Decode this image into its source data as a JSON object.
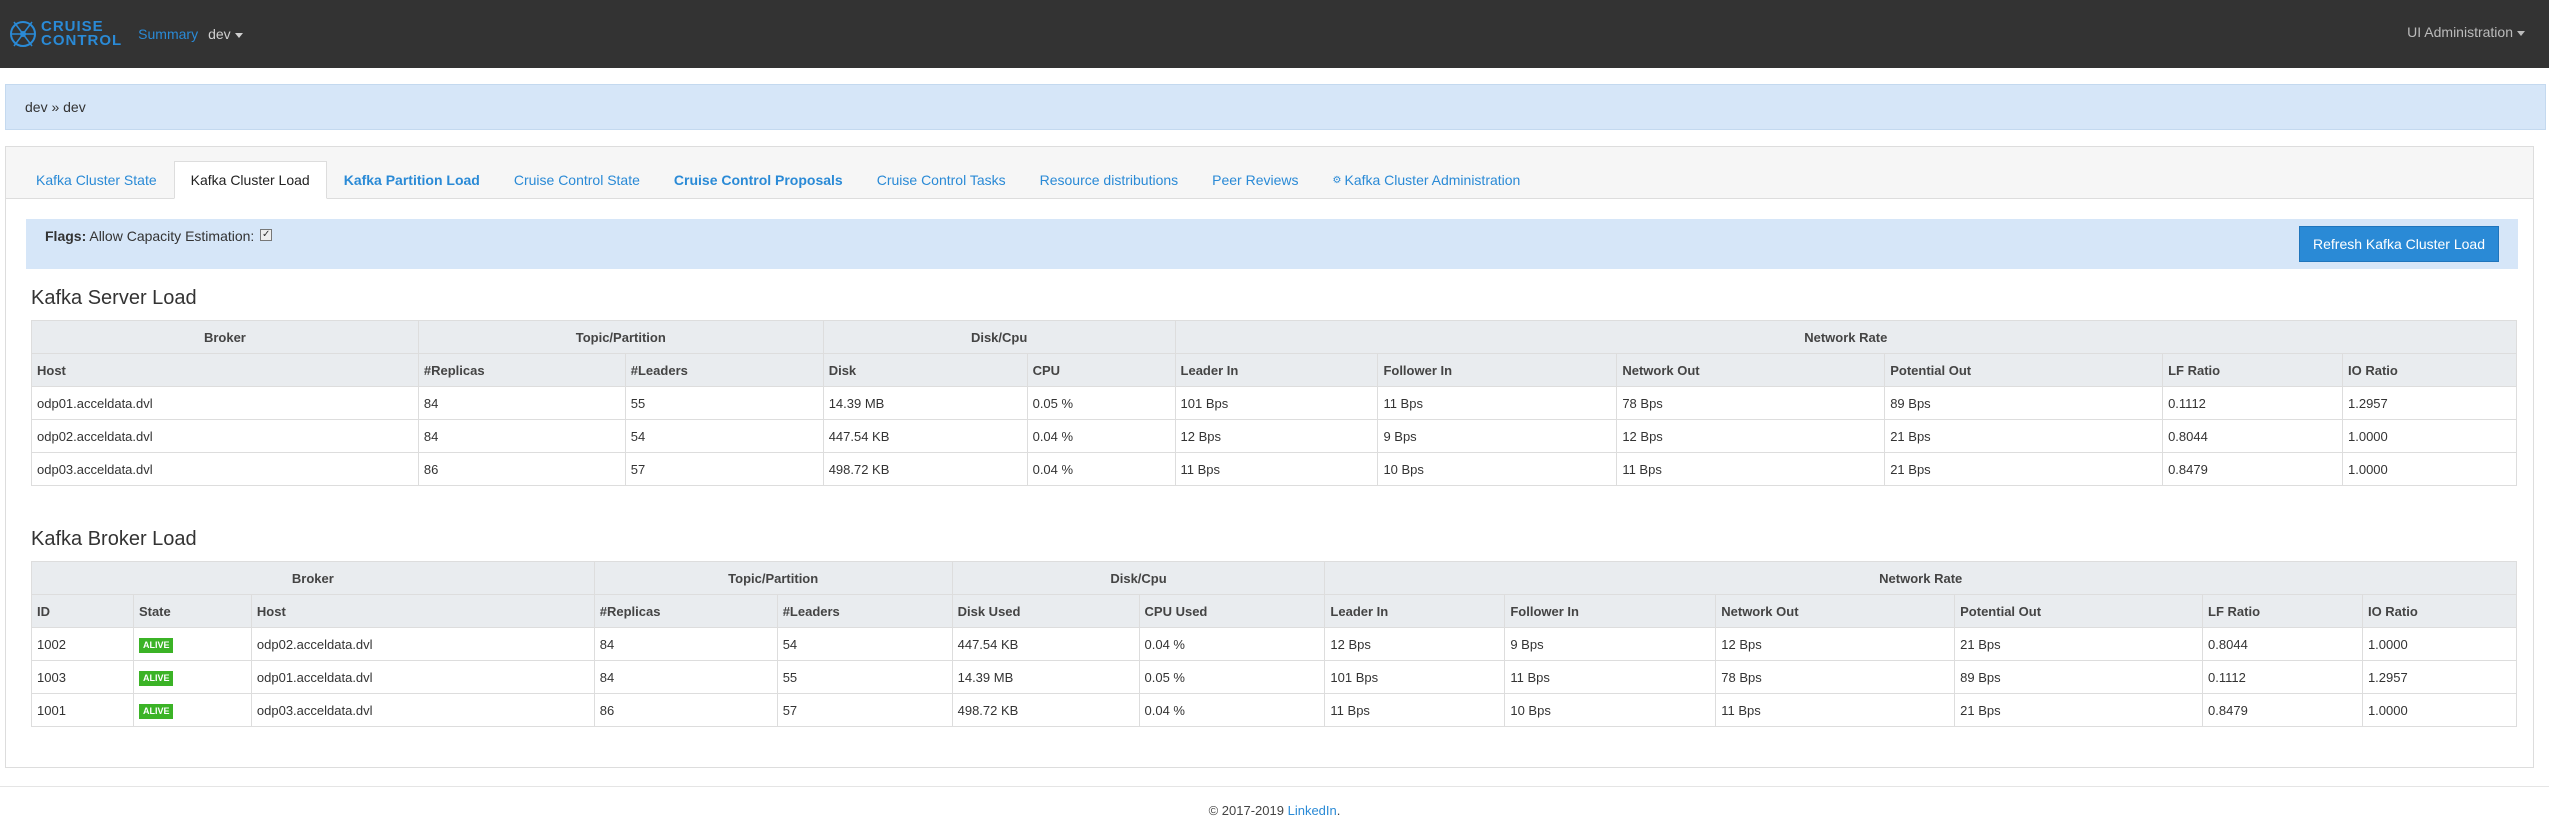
{
  "header": {
    "logo_line1": "CRUISE",
    "logo_line2": "CONTROL",
    "summary_link": "Summary",
    "env": "dev",
    "admin": "UI Administration"
  },
  "breadcrumb": "dev » dev",
  "tabs": [
    {
      "label": "Kafka Cluster State"
    },
    {
      "label": "Kafka Cluster Load"
    },
    {
      "label": "Kafka Partition Load"
    },
    {
      "label": "Cruise Control State"
    },
    {
      "label": "Cruise Control Proposals"
    },
    {
      "label": "Cruise Control Tasks"
    },
    {
      "label": "Resource distributions"
    },
    {
      "label": "Peer Reviews"
    },
    {
      "label": "Kafka Cluster Administration"
    }
  ],
  "flags": {
    "label": "Flags:",
    "text": "Allow Capacity Estimation:",
    "refresh_button": "Refresh Kafka Cluster Load"
  },
  "server_load": {
    "title": "Kafka Server Load",
    "groups": [
      "Broker",
      "Topic/Partition",
      "Disk/Cpu",
      "Network Rate"
    ],
    "columns": [
      "Host",
      "#Replicas",
      "#Leaders",
      "Disk",
      "CPU",
      "Leader In",
      "Follower In",
      "Network Out",
      "Potential Out",
      "LF Ratio",
      "IO Ratio"
    ],
    "rows": [
      [
        "odp01.acceldata.dvl",
        "84",
        "55",
        "14.39 MB",
        "0.05 %",
        "101 Bps",
        "11 Bps",
        "78 Bps",
        "89 Bps",
        "0.1112",
        "1.2957"
      ],
      [
        "odp02.acceldata.dvl",
        "84",
        "54",
        "447.54 KB",
        "0.04 %",
        "12 Bps",
        "9 Bps",
        "12 Bps",
        "21 Bps",
        "0.8044",
        "1.0000"
      ],
      [
        "odp03.acceldata.dvl",
        "86",
        "57",
        "498.72 KB",
        "0.04 %",
        "11 Bps",
        "10 Bps",
        "11 Bps",
        "21 Bps",
        "0.8479",
        "1.0000"
      ]
    ]
  },
  "broker_load": {
    "title": "Kafka Broker Load",
    "groups": [
      "Broker",
      "Topic/Partition",
      "Disk/Cpu",
      "Network Rate"
    ],
    "columns": [
      "ID",
      "State",
      "Host",
      "#Replicas",
      "#Leaders",
      "Disk Used",
      "CPU Used",
      "Leader In",
      "Follower In",
      "Network Out",
      "Potential Out",
      "LF Ratio",
      "IO Ratio"
    ],
    "rows": [
      [
        "1002",
        "ALIVE",
        "odp02.acceldata.dvl",
        "84",
        "54",
        "447.54 KB",
        "0.04 %",
        "12 Bps",
        "9 Bps",
        "12 Bps",
        "21 Bps",
        "0.8044",
        "1.0000"
      ],
      [
        "1003",
        "ALIVE",
        "odp01.acceldata.dvl",
        "84",
        "55",
        "14.39 MB",
        "0.05 %",
        "101 Bps",
        "11 Bps",
        "78 Bps",
        "89 Bps",
        "0.1112",
        "1.2957"
      ],
      [
        "1001",
        "ALIVE",
        "odp03.acceldata.dvl",
        "86",
        "57",
        "498.72 KB",
        "0.04 %",
        "11 Bps",
        "10 Bps",
        "11 Bps",
        "21 Bps",
        "0.8479",
        "1.0000"
      ]
    ]
  },
  "footer": {
    "text": "© 2017-2019",
    "link": "LinkedIn",
    "suffix": "."
  },
  "colors": {
    "accent": "#2a8ad6",
    "navbar": "#333333",
    "alive": "#3bb326",
    "info_bg": "#d6e6f8"
  }
}
